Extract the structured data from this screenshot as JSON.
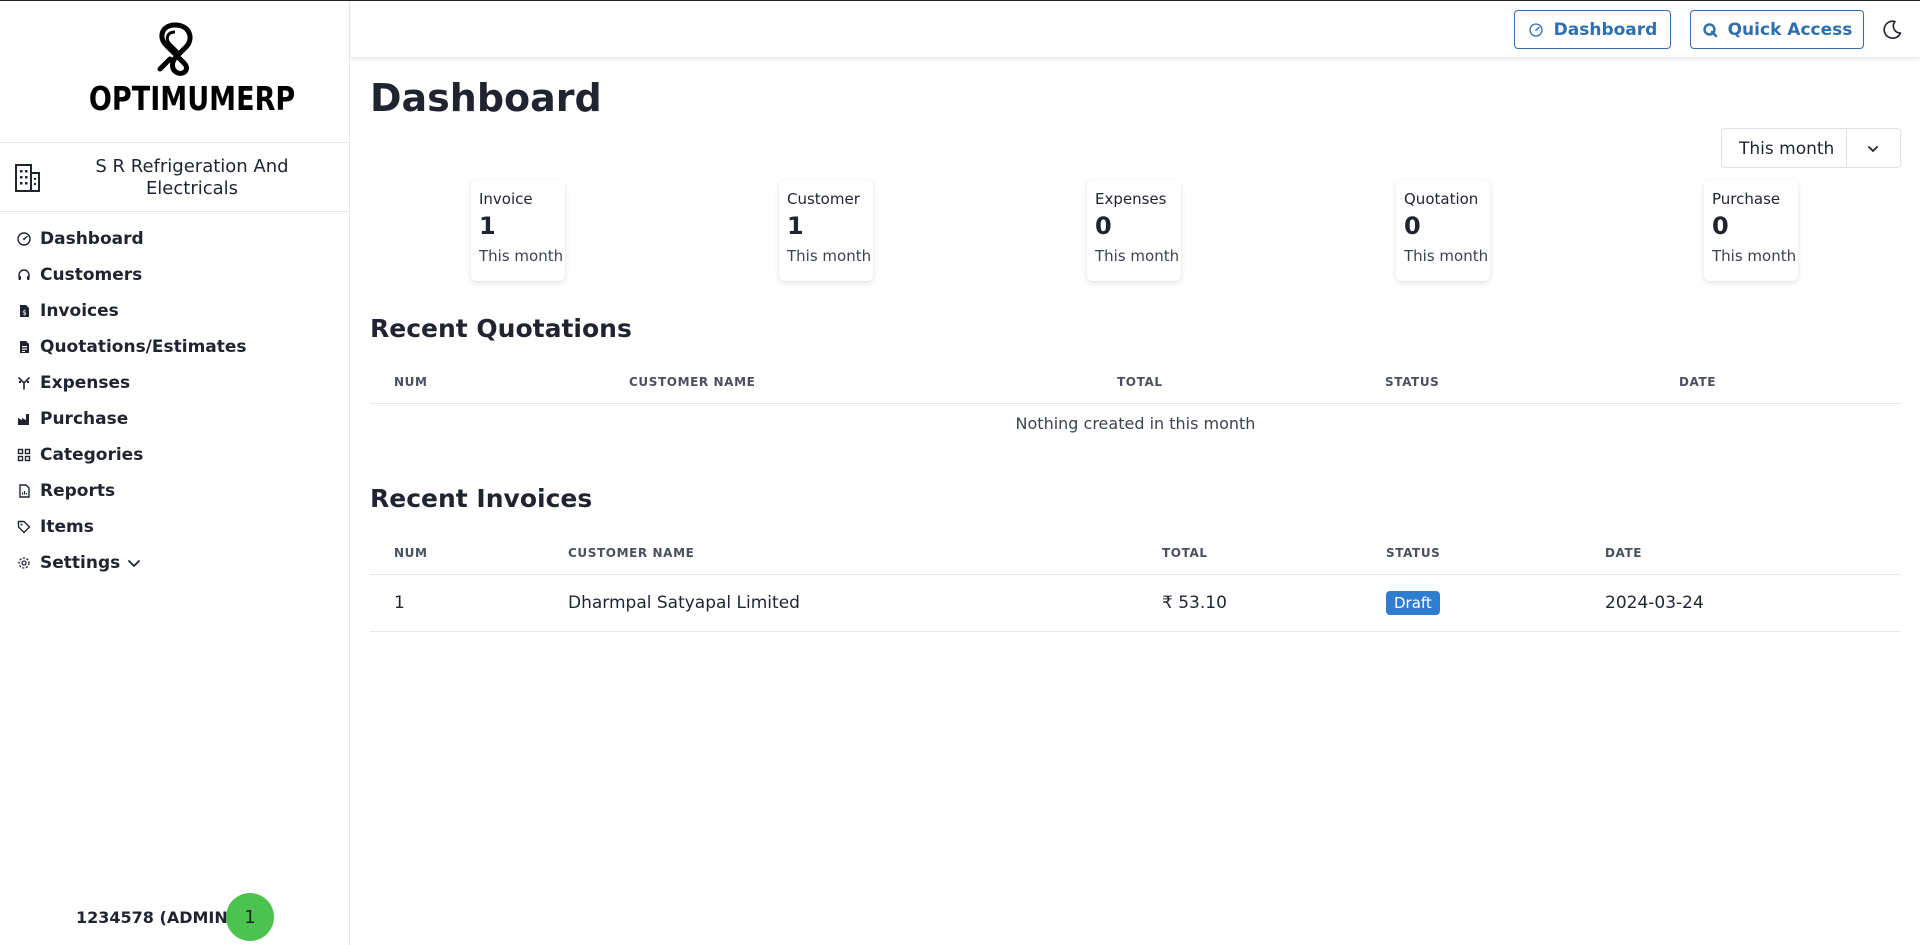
{
  "brand": {
    "logo_text": "OPTIMUMERP"
  },
  "company": {
    "name": "S R Refrigeration And Electricals"
  },
  "sidebar": {
    "items": [
      {
        "label": "Dashboard",
        "icon": "gauge-icon"
      },
      {
        "label": "Customers",
        "icon": "headset-icon"
      },
      {
        "label": "Invoices",
        "icon": "invoice-icon"
      },
      {
        "label": "Quotations/Estimates",
        "icon": "document-icon"
      },
      {
        "label": "Expenses",
        "icon": "expenses-icon"
      },
      {
        "label": "Purchase",
        "icon": "factory-icon"
      },
      {
        "label": "Categories",
        "icon": "grid-icon"
      },
      {
        "label": "Reports",
        "icon": "report-icon"
      },
      {
        "label": "Items",
        "icon": "tag-icon"
      },
      {
        "label": "Settings",
        "icon": "gear-icon"
      }
    ]
  },
  "user": {
    "name": "1234578 (ADMIN)",
    "avatar_text": "1",
    "avatar_color": "#4cc34f"
  },
  "topbar": {
    "dashboard_label": "Dashboard",
    "quick_access_label": "Quick Access",
    "accent_color": "#2f6fb0"
  },
  "page": {
    "title": "Dashboard"
  },
  "period": {
    "selected": "This month"
  },
  "stats": [
    {
      "label": "Invoice",
      "value": "1",
      "sub": "This month"
    },
    {
      "label": "Customer",
      "value": "1",
      "sub": "This month"
    },
    {
      "label": "Expenses",
      "value": "0",
      "sub": "This month"
    },
    {
      "label": "Quotation",
      "value": "0",
      "sub": "This month"
    },
    {
      "label": "Purchase",
      "value": "0",
      "sub": "This month"
    }
  ],
  "recent_quotations": {
    "title": "Recent Quotations",
    "columns": [
      "NUM",
      "CUSTOMER NAME",
      "TOTAL",
      "STATUS",
      "DATE"
    ],
    "empty_text": "Nothing created in this month"
  },
  "recent_invoices": {
    "title": "Recent Invoices",
    "columns": [
      "NUM",
      "CUSTOMER NAME",
      "TOTAL",
      "STATUS",
      "DATE"
    ],
    "rows": [
      {
        "num": "1",
        "customer": "Dharmpal Satyapal Limited",
        "total": "₹ 53.10",
        "status": "Draft",
        "date": "2024-03-24"
      }
    ],
    "status_color": "#2f7dd1"
  }
}
